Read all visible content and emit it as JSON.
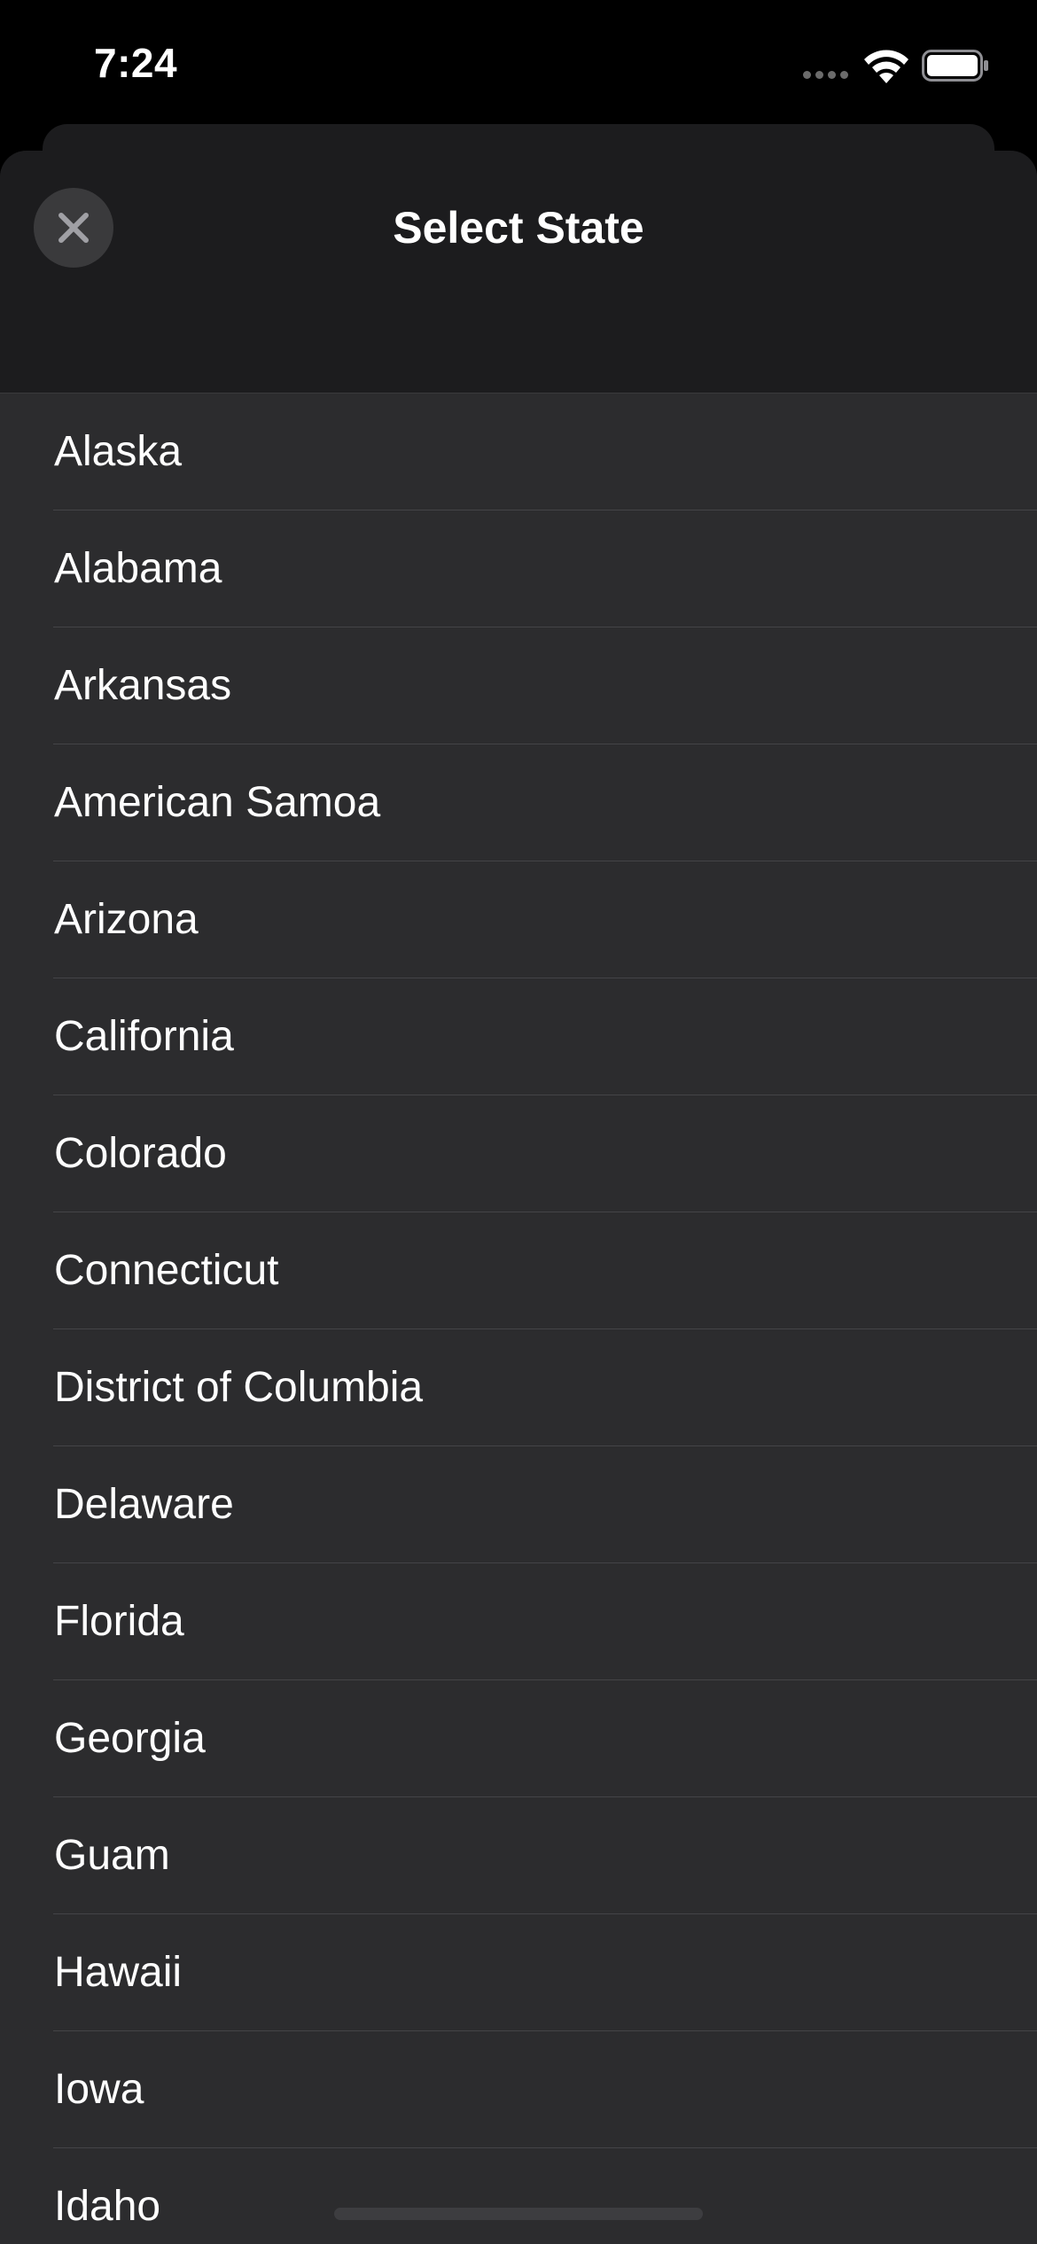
{
  "status_bar": {
    "time": "7:24",
    "icons": [
      "cellular-signal-icon",
      "wifi-icon",
      "battery-icon"
    ]
  },
  "sheet": {
    "title": "Select State",
    "close_icon": "close-icon"
  },
  "states": [
    {
      "label": "Alaska"
    },
    {
      "label": "Alabama"
    },
    {
      "label": "Arkansas"
    },
    {
      "label": "American Samoa"
    },
    {
      "label": "Arizona"
    },
    {
      "label": "California"
    },
    {
      "label": "Colorado"
    },
    {
      "label": "Connecticut"
    },
    {
      "label": "District of Columbia"
    },
    {
      "label": "Delaware"
    },
    {
      "label": "Florida"
    },
    {
      "label": "Georgia"
    },
    {
      "label": "Guam"
    },
    {
      "label": "Hawaii"
    },
    {
      "label": "Iowa"
    },
    {
      "label": "Idaho"
    }
  ],
  "colors": {
    "background": "#000000",
    "sheet": "#1c1c1e",
    "list": "#2c2c2e",
    "separator": "#444447",
    "close_button": "#3a3a3c",
    "close_glyph": "#a0a0a5",
    "text": "#ffffff"
  }
}
